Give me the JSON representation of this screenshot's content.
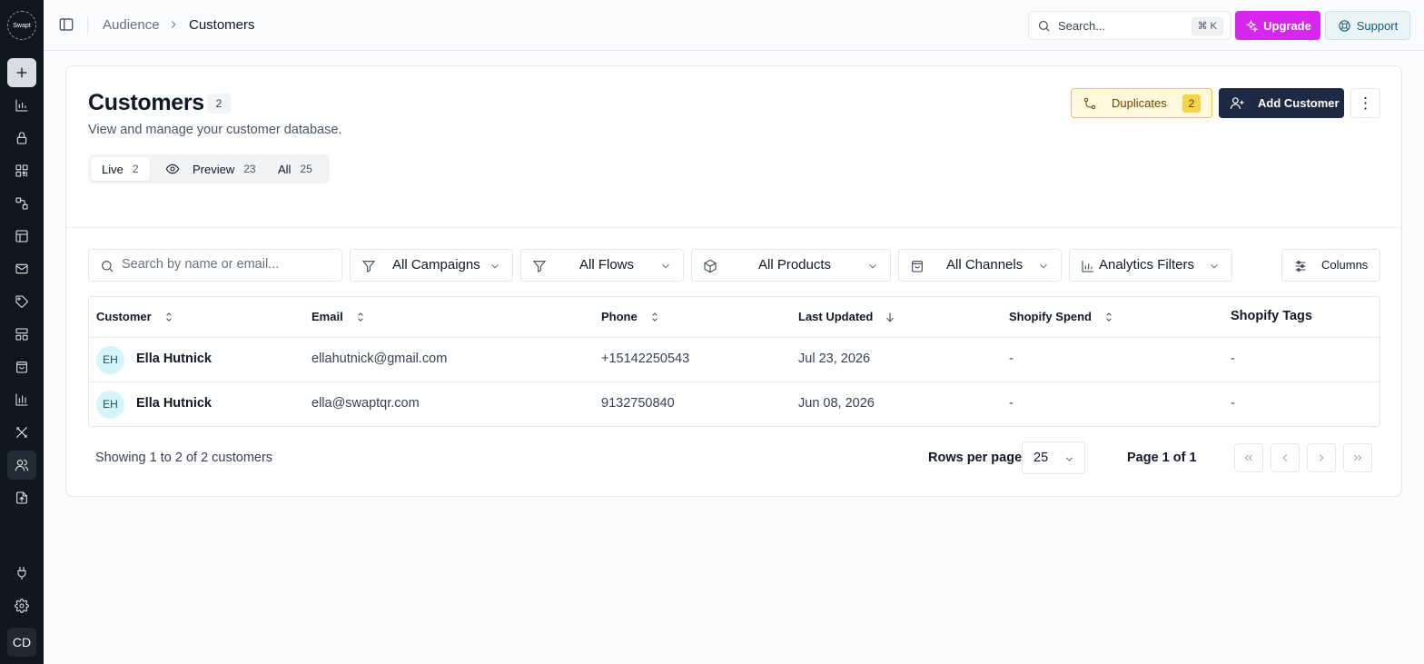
{
  "app": {
    "logo_text": "Swapt"
  },
  "colors": {
    "sidebar": "#0f1720",
    "upgrade": "#d626ef",
    "primary": "#1e2a44",
    "duplicates_bg": "#fff8dd",
    "avatar_bg": "#d5f5fa"
  },
  "sidebar": {
    "items": [
      {
        "icon": "plus-icon"
      },
      {
        "icon": "bar-chart-icon"
      },
      {
        "icon": "lock-icon"
      },
      {
        "icon": "qr-code-icon"
      },
      {
        "icon": "flow-icon"
      },
      {
        "icon": "layout-icon"
      },
      {
        "icon": "mail-icon"
      },
      {
        "icon": "tag-icon"
      },
      {
        "icon": "grid-icon"
      },
      {
        "icon": "shopping-bag-icon"
      },
      {
        "icon": "analytics-icon"
      },
      {
        "icon": "tools-icon"
      },
      {
        "icon": "users-icon"
      },
      {
        "icon": "file-upload-icon"
      },
      {
        "icon": "plug-icon"
      },
      {
        "icon": "settings-icon"
      }
    ],
    "user_initials": "CD"
  },
  "header": {
    "breadcrumb": [
      "Audience",
      "Customers"
    ],
    "search_placeholder": "Search...",
    "search_shortcut": "⌘ K",
    "upgrade_label": "Upgrade",
    "support_label": "Support"
  },
  "page": {
    "title": "Customers",
    "count": "2",
    "subtitle": "View and manage your customer database.",
    "tabs": [
      {
        "label": "Live",
        "count": "2"
      },
      {
        "label": "Preview",
        "count": "23"
      },
      {
        "label": "All",
        "count": "25"
      }
    ],
    "duplicates_label": "Duplicates",
    "duplicates_count": "2",
    "add_customer_label": "Add Customer",
    "more_label": "⋮"
  },
  "filters": {
    "search_placeholder": "Search by name or email...",
    "campaigns": "All Campaigns",
    "flows": "All Flows",
    "products": "All Products",
    "channels": "All Channels",
    "analytics": "Analytics Filters",
    "columns": "Columns"
  },
  "table": {
    "columns": [
      "Customer",
      "Email",
      "Phone",
      "Last Updated",
      "Shopify Spend",
      "Shopify Tags"
    ],
    "rows": [
      {
        "initials": "EH",
        "name": "Ella Hutnick",
        "email": "ellahutnick@gmail.com",
        "phone": "+15142250543",
        "last_updated": "Jul 23, 2026",
        "spend": "-",
        "tags": "-"
      },
      {
        "initials": "EH",
        "name": "Ella Hutnick",
        "email": "ella@swaptqr.com",
        "phone": "9132750840",
        "last_updated": "Jun 08, 2026",
        "spend": "-",
        "tags": "-"
      }
    ]
  },
  "footer": {
    "showing": "Showing 1 to 2 of 2 customers",
    "rows_per_page_label": "Rows per page",
    "rows_per_page_value": "25",
    "page_info": "Page 1 of 1"
  }
}
